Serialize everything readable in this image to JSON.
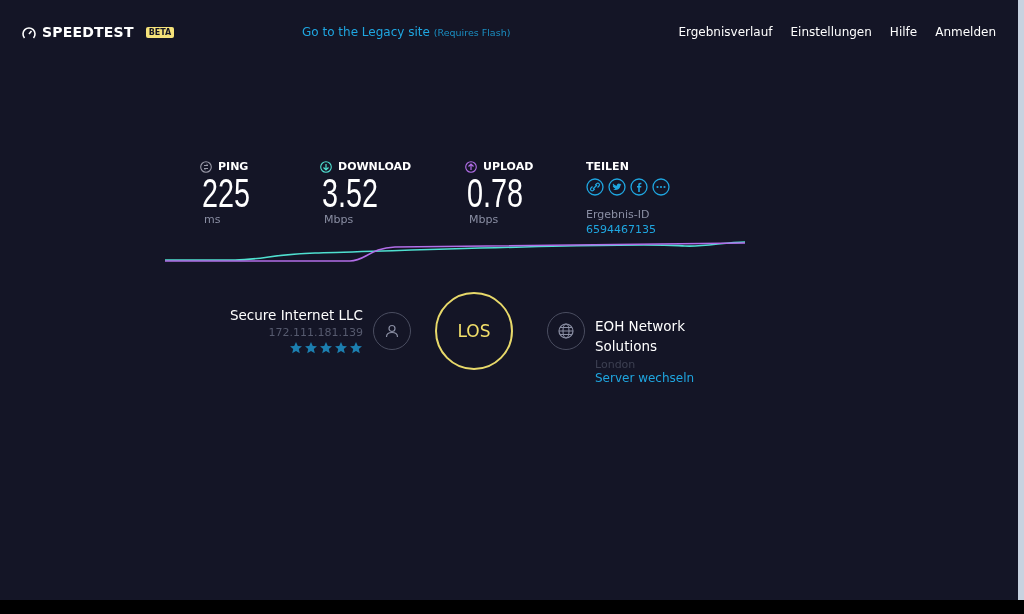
{
  "header": {
    "logo": "SPEEDTEST",
    "badge": "BETA",
    "legacy_link": "Go to the Legacy site",
    "legacy_note": "(Requires Flash)",
    "nav": [
      "Ergebnisverlauf",
      "Einstellungen",
      "Hilfe",
      "Anmelden"
    ]
  },
  "metrics": [
    {
      "kind": "ping",
      "label": "PING",
      "value": "225",
      "unit": "ms"
    },
    {
      "kind": "download",
      "label": "DOWNLOAD",
      "value": "3.52",
      "unit": "Mbps"
    },
    {
      "kind": "upload",
      "label": "UPLOAD",
      "value": "0.78",
      "unit": "Mbps"
    }
  ],
  "share": {
    "label": "TEILEN",
    "result_label": "Ergebnis-ID",
    "result_id": "6594467135"
  },
  "provider": {
    "name": "Secure Internet LLC",
    "ip": "172.111.181.139",
    "stars": 5
  },
  "start_button": "LOS",
  "server": {
    "name": "EOH Network Solutions",
    "location": "London",
    "change_link": "Server wechseln"
  }
}
